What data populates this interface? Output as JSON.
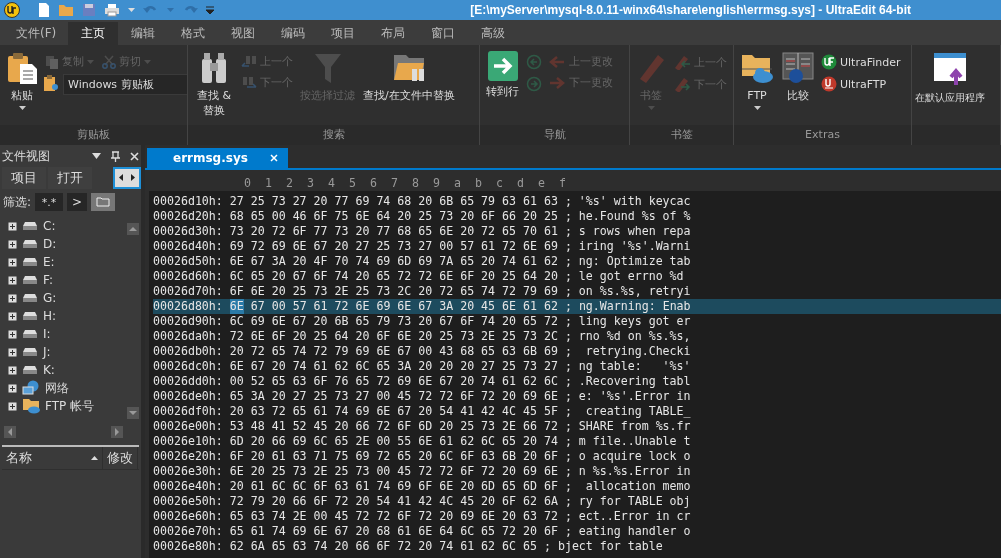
{
  "window": {
    "title": "[E:\\myServer\\mysql-8.0.11-winx64\\share\\english\\errmsg.sys] - UltraEdit 64-bit"
  },
  "menu_tabs": [
    {
      "label": "文件(F)",
      "selected": false
    },
    {
      "label": "主页",
      "selected": true
    },
    {
      "label": "编辑",
      "selected": false
    },
    {
      "label": "格式",
      "selected": false
    },
    {
      "label": "视图",
      "selected": false
    },
    {
      "label": "编码",
      "selected": false
    },
    {
      "label": "项目",
      "selected": false
    },
    {
      "label": "布局",
      "selected": false
    },
    {
      "label": "窗口",
      "selected": false
    },
    {
      "label": "高级",
      "selected": false
    }
  ],
  "ribbon": {
    "groups": [
      {
        "label": "剪贴板",
        "columns": [
          {
            "kind": "large",
            "label": "粘贴",
            "disabled": false,
            "dropdown": true
          },
          {
            "kind": "stack",
            "rows": [
              [
                {
                  "kind": "button",
                  "label": "复制",
                  "disabled": true,
                  "dropdown": true
                },
                {
                  "kind": "button",
                  "label": "剪切",
                  "disabled": true,
                  "dropdown": true
                }
              ],
              [
                {
                  "kind": "combo",
                  "label": "Windows 剪贴板",
                  "disabled": false
                }
              ]
            ]
          }
        ]
      },
      {
        "label": "搜索",
        "columns": [
          {
            "kind": "large",
            "label": "查找 & 替换",
            "disabled": false,
            "dropdown": false
          },
          {
            "kind": "stack",
            "rows": [
              [
                {
                  "kind": "button",
                  "label": "上一个",
                  "disabled": true,
                  "dropdown": false
                }
              ],
              [
                {
                  "kind": "button",
                  "label": "下一个",
                  "disabled": true,
                  "dropdown": false
                }
              ]
            ]
          },
          {
            "kind": "large",
            "label": "按选择过滤",
            "disabled": true,
            "dropdown": false
          },
          {
            "kind": "large",
            "label": "查找/在文件中替换",
            "disabled": false,
            "dropdown": false
          }
        ]
      },
      {
        "label": "导航",
        "columns": [
          {
            "kind": "large",
            "label": "转到行",
            "disabled": false,
            "dropdown": false
          },
          {
            "kind": "stack",
            "rows": [
              [
                {
                  "kind": "button",
                  "disabled": true,
                  "dropdown": false
                }
              ],
              [
                {
                  "kind": "button",
                  "disabled": true,
                  "dropdown": false
                }
              ]
            ]
          },
          {
            "kind": "stack",
            "rows": [
              [
                {
                  "kind": "button",
                  "label": "上一更改",
                  "disabled": true,
                  "dropdown": false
                }
              ],
              [
                {
                  "kind": "button",
                  "label": "下一更改",
                  "disabled": true,
                  "dropdown": false
                }
              ]
            ]
          }
        ]
      },
      {
        "label": "书签",
        "columns": [
          {
            "kind": "large",
            "label": "书签",
            "disabled": true,
            "dropdown": true
          },
          {
            "kind": "stack",
            "rows": [
              [
                {
                  "kind": "button",
                  "label": "上一个",
                  "disabled": true,
                  "dropdown": false
                }
              ],
              [
                {
                  "kind": "button",
                  "label": "下一个",
                  "disabled": true,
                  "dropdown": false
                }
              ]
            ]
          }
        ]
      },
      {
        "label": "Extras",
        "columns": [
          {
            "kind": "large",
            "label": "FTP",
            "disabled": false,
            "dropdown": true
          },
          {
            "kind": "large",
            "label": "比较",
            "disabled": false,
            "dropdown": false
          },
          {
            "kind": "stack",
            "rows": [
              [
                {
                  "kind": "button",
                  "label": "UltraFinder",
                  "disabled": false,
                  "dropdown": false
                }
              ],
              [
                {
                  "kind": "button",
                  "label": "UltraFTP",
                  "disabled": false,
                  "dropdown": false
                }
              ]
            ]
          }
        ]
      },
      {
        "columns": [
          {
            "kind": "large",
            "label": "在默认应用程序",
            "disabled": false,
            "dropdown": false
          }
        ]
      }
    ]
  },
  "file_view": {
    "title": "文件视图",
    "tabs": [
      {
        "label": "项目",
        "selected": false
      },
      {
        "label": "打开",
        "selected": false
      }
    ],
    "filter": {
      "label": "筛选:",
      "value": "*.*",
      "go": ">"
    },
    "tree": [
      {
        "kind": "drive",
        "label": "C:",
        "expanded": false
      },
      {
        "kind": "drive",
        "label": "D:",
        "expanded": false
      },
      {
        "kind": "drive",
        "label": "E:",
        "expanded": false
      },
      {
        "kind": "drive",
        "label": "F:",
        "expanded": false
      },
      {
        "kind": "drive",
        "label": "G:",
        "expanded": false
      },
      {
        "kind": "drive",
        "label": "H:",
        "expanded": false
      },
      {
        "kind": "drive",
        "label": "I:",
        "expanded": false
      },
      {
        "kind": "drive",
        "label": "J:",
        "expanded": false
      },
      {
        "kind": "drive",
        "label": "K:",
        "expanded": false
      },
      {
        "kind": "network",
        "label": "网络",
        "expanded": false
      },
      {
        "kind": "ftp",
        "label": "FTP 帐号",
        "expanded": false
      }
    ],
    "list_columns": [
      {
        "label": "名称",
        "sorted": true
      },
      {
        "label": "修改",
        "sorted": false
      }
    ]
  },
  "document_tabs": [
    {
      "label": "errmsg.sys",
      "selected": true
    }
  ],
  "hex_view": {
    "column_headers": [
      "0",
      "1",
      "2",
      "3",
      "4",
      "5",
      "6",
      "7",
      "8",
      "9",
      "a",
      "b",
      "c",
      "d",
      "e",
      "f"
    ],
    "rows": [
      {
        "address": "00026d10h:",
        "bytes": "27 25 73 27 20 77 69 74 68 20 6B 65 79 63 61 63",
        "sep": ";",
        "text": "'%s' with keycac",
        "selected": false
      },
      {
        "address": "00026d20h:",
        "bytes": "68 65 00 46 6F 75 6E 64 20 25 73 20 6F 66 20 25",
        "sep": ";",
        "text": "he.Found %s of %",
        "selected": false
      },
      {
        "address": "00026d30h:",
        "bytes": "73 20 72 6F 77 73 20 77 68 65 6E 20 72 65 70 61",
        "sep": ";",
        "text": "s rows when repa",
        "selected": false
      },
      {
        "address": "00026d40h:",
        "bytes": "69 72 69 6E 67 20 27 25 73 27 00 57 61 72 6E 69",
        "sep": ";",
        "text": "iring '%s'.Warni",
        "selected": false
      },
      {
        "address": "00026d50h:",
        "bytes": "6E 67 3A 20 4F 70 74 69 6D 69 7A 65 20 74 61 62",
        "sep": ";",
        "text": "ng: Optimize tab",
        "selected": false
      },
      {
        "address": "00026d60h:",
        "bytes": "6C 65 20 67 6F 74 20 65 72 72 6E 6F 20 25 64 20",
        "sep": ";",
        "text": "le got errno %d",
        "selected": false
      },
      {
        "address": "00026d70h:",
        "bytes": "6F 6E 20 25 73 2E 25 73 2C 20 72 65 74 72 79 69",
        "sep": ";",
        "text": "on %s.%s, retryi",
        "selected": false
      },
      {
        "address": "00026d80h:",
        "cursor": "6E",
        "bytes": "67 00 57 61 72 6E 69 6E 67 3A 20 45 6E 61 62",
        "sep": ";",
        "text": "ng.Warning: Enab",
        "selected": true
      },
      {
        "address": "00026d90h:",
        "bytes": "6C 69 6E 67 20 6B 65 79 73 20 67 6F 74 20 65 72",
        "sep": ";",
        "text": "ling keys got er",
        "selected": false
      },
      {
        "address": "00026da0h:",
        "bytes": "72 6E 6F 20 25 64 20 6F 6E 20 25 73 2E 25 73 2C",
        "sep": ";",
        "text": "rno %d on %s.%s,",
        "selected": false
      },
      {
        "address": "00026db0h:",
        "bytes": "20 72 65 74 72 79 69 6E 67 00 43 68 65 63 6B 69",
        "sep": ";",
        "text": " retrying.Checki",
        "selected": false
      },
      {
        "address": "00026dc0h:",
        "bytes": "6E 67 20 74 61 62 6C 65 3A 20 20 20 27 25 73 27",
        "sep": ";",
        "text": "ng table:   '%s'",
        "selected": false
      },
      {
        "address": "00026dd0h:",
        "bytes": "00 52 65 63 6F 76 65 72 69 6E 67 20 74 61 62 6C",
        "sep": ";",
        "text": ".Recovering tabl",
        "selected": false
      },
      {
        "address": "00026de0h:",
        "bytes": "65 3A 20 27 25 73 27 00 45 72 72 6F 72 20 69 6E",
        "sep": ";",
        "text": "e: '%s'.Error in",
        "selected": false
      },
      {
        "address": "00026df0h:",
        "bytes": "20 63 72 65 61 74 69 6E 67 20 54 41 42 4C 45 5F",
        "sep": ";",
        "text": " creating TABLE_",
        "selected": false
      },
      {
        "address": "00026e00h:",
        "bytes": "53 48 41 52 45 20 66 72 6F 6D 20 25 73 2E 66 72",
        "sep": ";",
        "text": "SHARE from %s.fr",
        "selected": false
      },
      {
        "address": "00026e10h:",
        "bytes": "6D 20 66 69 6C 65 2E 00 55 6E 61 62 6C 65 20 74",
        "sep": ";",
        "text": "m file..Unable t",
        "selected": false
      },
      {
        "address": "00026e20h:",
        "bytes": "6F 20 61 63 71 75 69 72 65 20 6C 6F 63 6B 20 6F",
        "sep": ";",
        "text": "o acquire lock o",
        "selected": false
      },
      {
        "address": "00026e30h:",
        "bytes": "6E 20 25 73 2E 25 73 00 45 72 72 6F 72 20 69 6E",
        "sep": ";",
        "text": "n %s.%s.Error in",
        "selected": false
      },
      {
        "address": "00026e40h:",
        "bytes": "20 61 6C 6C 6F 63 61 74 69 6F 6E 20 6D 65 6D 6F",
        "sep": ";",
        "text": " allocation memo",
        "selected": false
      },
      {
        "address": "00026e50h:",
        "bytes": "72 79 20 66 6F 72 20 54 41 42 4C 45 20 6F 62 6A",
        "sep": ";",
        "text": "ry for TABLE obj",
        "selected": false
      },
      {
        "address": "00026e60h:",
        "bytes": "65 63 74 2E 00 45 72 72 6F 72 20 69 6E 20 63 72",
        "sep": ";",
        "text": "ect..Error in cr",
        "selected": false
      },
      {
        "address": "00026e70h:",
        "bytes": "65 61 74 69 6E 67 20 68 61 6E 64 6C 65 72 20 6F",
        "sep": ";",
        "text": "eating handler o",
        "selected": false
      },
      {
        "address": "00026e80h:",
        "bytes": "62 6A 65 63 74 20 66 6F 72 20 74 61 62 6C 65",
        "sep": ";",
        "text": "bject for table",
        "selected": false
      }
    ]
  }
}
